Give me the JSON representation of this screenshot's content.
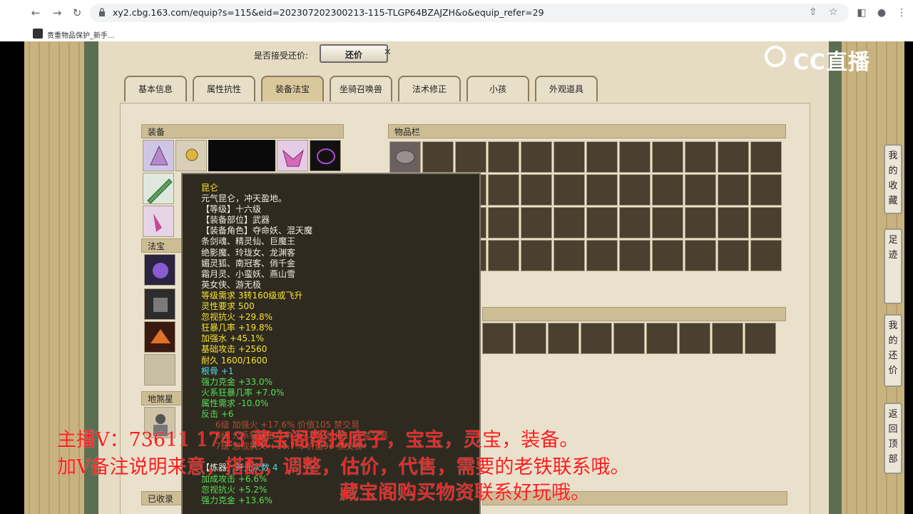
{
  "browser": {
    "url": "xy2.cbg.163.com/equip?s=115&eid=202307202300213-115-TLGP64BZAJZH&o&equip_refer=29",
    "bookmark": "贵重物品保护_新手..."
  },
  "accept_offer": {
    "label": "是否接受还价:",
    "button": "还价"
  },
  "tabs": [
    "基本信息",
    "属性抗性",
    "装备法宝",
    "坐骑召唤兽",
    "法术修正",
    "小孩",
    "外观道具"
  ],
  "active_tab": "装备法宝",
  "sections": {
    "equipment": "装备",
    "treasure": "法宝",
    "items": "物品栏",
    "dishagang": "地煞星",
    "collected": "已收录"
  },
  "tooltip": {
    "name": "昆仑",
    "desc": "元气昆仑，冲天盈地。",
    "level": "【等级】十六级",
    "slot": "【装备部位】武器",
    "roles_title": "【装备角色】夺命妖、混天魔",
    "roles": [
      "条剑魂、精灵仙、巨魔王",
      "绝影魔、玲珑女、龙渊客",
      "媚灵狐、南冠客、俏千金",
      "霜月灵、小蛮妖、燕山雪",
      "英女侠、游无极"
    ],
    "req_level": "等级需求 3转160级或飞升",
    "req_spirit": "灵性要求 500",
    "stats": [
      "忽视抗火 +29.8%",
      "狂暴几率 +19.8%",
      "加强水 +45.1%",
      "基础攻击 +2560",
      "耐久 1600/1600"
    ],
    "bone": "根骨 +1",
    "green_stats": [
      "强力克金 +33.0%",
      "火系狂暴几率 +7.0%",
      "属性需求 -10.0%",
      "反击 +6"
    ],
    "refine": [
      "6级 加强火 +17.6% 价值105 禁交易",
      "6级 火系狂暴击几率 +7.0% 价值108 禁交易",
      "7级 忽视抗火 +10.7% 价值96 禁交易"
    ],
    "lianqi_label": "【炼器】",
    "lianqi_count": "开光次数 4",
    "lianqi_stats": [
      "加成攻击 +6.6%",
      "忽视抗火 +5.2%",
      "强力克金 +13.6%"
    ]
  },
  "side_buttons": [
    {
      "label": "我的收藏"
    },
    {
      "label": "足迹"
    },
    {
      "label": "我的还价"
    },
    {
      "label": "返回顶部"
    }
  ],
  "overlay": {
    "line1": "主播V：73611 1743   藏宝阁帮找底子，宝宝，灵宝，装备。",
    "line2": "加V备注说明来意，搭配，调整，估价，代售，需要的老铁联系哦。",
    "line3": "藏宝阁购买物资联系好玩哦。",
    "logo": "CC直播"
  }
}
